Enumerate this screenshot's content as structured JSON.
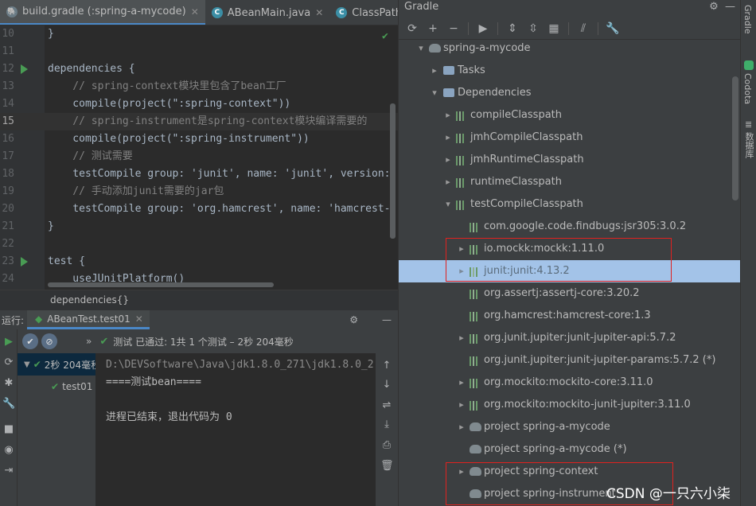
{
  "tabs": [
    {
      "label": "build.gradle (:spring-a-mycode)",
      "icon": "gradle-icon",
      "active": true
    },
    {
      "label": "ABeanMain.java",
      "icon": "java-class-icon",
      "active": false
    },
    {
      "label": "ClassPathXm",
      "icon": "java-class-icon",
      "active": false
    }
  ],
  "editor": {
    "lines": [
      {
        "num": "10",
        "text": "}"
      },
      {
        "num": "11",
        "text": ""
      },
      {
        "num": "12",
        "text": "dependencies {"
      },
      {
        "num": "13",
        "text": "    // spring-context模块里包含了bean工厂"
      },
      {
        "num": "14",
        "text": "    compile(project(\":spring-context\"))"
      },
      {
        "num": "15",
        "text": "    // spring-instrument是spring-context模块编译需要的"
      },
      {
        "num": "16",
        "text": "    compile(project(\":spring-instrument\"))"
      },
      {
        "num": "17",
        "text": "    // 测试需要"
      },
      {
        "num": "18",
        "text": "    testCompile group: 'junit', name: 'junit', version:"
      },
      {
        "num": "19",
        "text": "    // 手动添加junit需要的jar包"
      },
      {
        "num": "20",
        "text": "    testCompile group: 'org.hamcrest', name: 'hamcrest-"
      },
      {
        "num": "21",
        "text": "}"
      },
      {
        "num": "22",
        "text": ""
      },
      {
        "num": "23",
        "text": "test {"
      },
      {
        "num": "24",
        "text": "    useJUnitPlatform()"
      }
    ],
    "breadcrumb": "dependencies{}"
  },
  "run": {
    "label": "运行:",
    "tab": "ABeanTest.test01",
    "status": "测试 已通过: 1共 1 个测试 – 2秒 204毫秒",
    "tree": [
      {
        "label": "2秒 204毫秒"
      },
      {
        "label": "test01"
      }
    ],
    "console": [
      "D:\\DEVSoftware\\Java\\jdk1.8.0_271\\jdk1.8.0_2",
      "====测试bean====",
      "",
      "进程已结束，退出代码为 0"
    ]
  },
  "gradle": {
    "title": "Gradle",
    "project": "spring-a-mycode",
    "tasks": "Tasks",
    "dependencies": "Dependencies",
    "configs": [
      "compileClasspath",
      "jmhCompileClasspath",
      "jmhRuntimeClasspath",
      "runtimeClasspath",
      "testCompileClasspath"
    ],
    "libs": [
      "com.google.code.findbugs:jsr305:3.0.2",
      "io.mockk:mockk:1.11.0",
      "junit:junit:4.13.2",
      "org.assertj:assertj-core:3.20.2",
      "org.hamcrest:hamcrest-core:1.3",
      "org.junit.jupiter:junit-jupiter-api:5.7.2",
      "org.junit.jupiter:junit-jupiter-params:5.7.2 (*)",
      "org.mockito:mockito-core:3.11.0",
      "org.mockito:mockito-junit-jupiter:3.11.0",
      "project spring-a-mycode",
      "project spring-a-mycode (*)",
      "project spring-context",
      "project spring-instrument"
    ]
  },
  "side_tabs": [
    "Gradle",
    "Codota",
    "数据库"
  ],
  "watermark": "CSDN @一只六小柒",
  "colors": {
    "accent": "#4a88c7",
    "selection": "#a3c3e8",
    "highlight_box": "#e0211f",
    "pass": "#499c54"
  }
}
